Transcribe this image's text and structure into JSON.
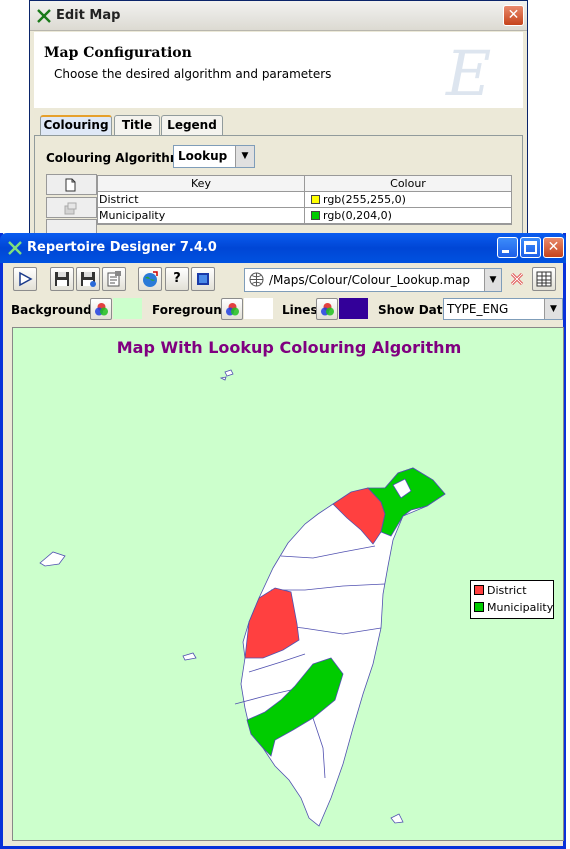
{
  "edit_map": {
    "title": "Edit Map",
    "header_title": "Map Configuration",
    "header_subtitle": "Choose the desired algorithm and parameters",
    "header_logo": "E",
    "tabs": [
      {
        "label": "Colouring",
        "active": true
      },
      {
        "label": "Title",
        "active": false
      },
      {
        "label": "Legend",
        "active": false
      }
    ],
    "algorithm_label": "Colouring Algorithm:",
    "algorithm_value": "Lookup",
    "table": {
      "headers": [
        "Key",
        "Colour"
      ],
      "rows": [
        {
          "key": "District",
          "colour": "rgb(255,255,0)",
          "swatch": "#ffff00"
        },
        {
          "key": "Municipality",
          "colour": "rgb(0,204,0)",
          "swatch": "#00cc00"
        }
      ]
    }
  },
  "designer": {
    "title": "Repertoire Designer 7.4.0",
    "toolbar": {
      "run_icon": "play-icon",
      "save_icon": "floppy-icon",
      "save_as_icon": "floppy-saveas-icon",
      "properties_icon": "properties-icon",
      "web_icon": "globe-icon",
      "help_label": "?",
      "export_icon": "image-icon",
      "path_value": "/Maps/Colour/Colour_Lookup.map",
      "close_map_icon": "close-x-icon",
      "table_icon": "table-icon"
    },
    "props": {
      "background_label": "Background:",
      "foreground_label": "Foreground:",
      "lines_label": "Lines:",
      "show_data_label": "Show Data:",
      "show_data_value": "TYPE_ENG",
      "background_color": "#ccffcc",
      "foreground_color": "#ffffff",
      "lines_color": "#330099"
    },
    "map": {
      "title": "Map With Lookup Colouring Algorithm",
      "title_color": "#800080",
      "background": "#ccffcc",
      "legend": [
        {
          "label": "District",
          "color": "#ff4040"
        },
        {
          "label": "Municipality",
          "color": "#00cc00"
        }
      ]
    }
  }
}
